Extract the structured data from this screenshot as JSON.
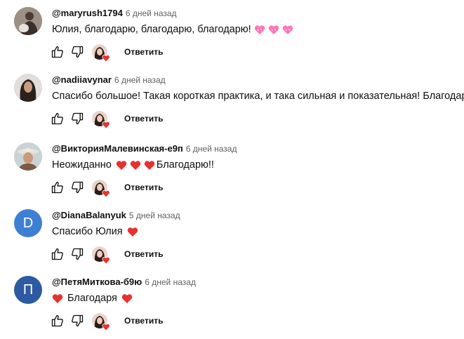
{
  "reply_label": "Ответить",
  "colors": {
    "heart_red": "#e8312f",
    "heart_pink": "#ff77b8",
    "avatar_d": "#3f7fd3",
    "avatar_p": "#2d5aa0"
  },
  "comments": [
    {
      "author": "@maryrush1794",
      "time": "6 дней назад",
      "avatar": "photo-woman-with-dog",
      "parts": [
        "Юлия, благодарю, благодарю, благодарю!"
      ],
      "emoji": [
        "pink-heart",
        "pink-heart",
        "pink-heart"
      ]
    },
    {
      "author": "@nadiiavynar",
      "time": "6 дней назад",
      "avatar": "photo-woman-portrait",
      "parts": [
        "Спасибо большое! Такая короткая практика, и така сильная и показательная! Благодарю."
      ]
    },
    {
      "author": "@ВикторияМалевинская-е9п",
      "time": "6 дней назад",
      "avatar": "photo-man-with-hat",
      "parts": [
        "Неожиданно",
        "Благодарю!!"
      ],
      "emoji": [
        "red-heart",
        "red-heart",
        "red-heart"
      ]
    },
    {
      "author": "@DianaBalanyuk",
      "time": "5 дней назад",
      "avatar_letter": "D",
      "parts": [
        "Спасибо Юлия"
      ],
      "emoji": [
        "red-heart"
      ]
    },
    {
      "author": "@ПетяМиткова-б9ю",
      "time": "6 дней назад",
      "avatar_letter": "П",
      "parts": [
        "Благодаря"
      ],
      "emoji": [
        "red-heart",
        "red-heart"
      ]
    }
  ]
}
